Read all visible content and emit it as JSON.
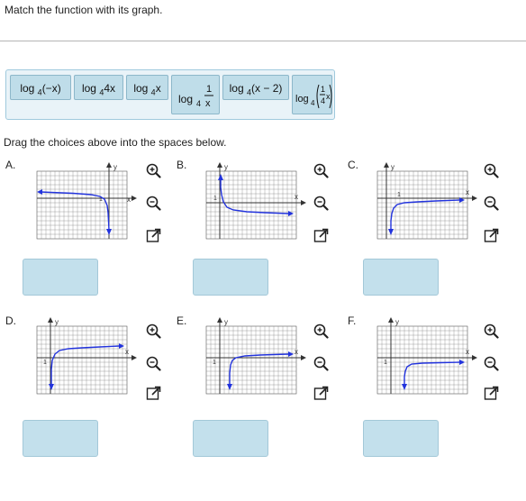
{
  "question": {
    "prompt": "Match the function with its graph."
  },
  "choices": [
    {
      "id": "c1",
      "text": "log 4(−x)"
    },
    {
      "id": "c2",
      "text": "log 4 4x"
    },
    {
      "id": "c3",
      "text": "log 4 x"
    },
    {
      "id": "c4",
      "text": "log 4 1/x",
      "prefix": "log",
      "sub": "4",
      "num": "1",
      "den": "x"
    },
    {
      "id": "c5",
      "text": "log 4(x − 2)"
    },
    {
      "id": "c6",
      "text": "log 4 (1/4 x)",
      "prefix": "log",
      "sub": "4",
      "num": "1",
      "den": "4",
      "var": "x"
    }
  ],
  "instruction": "Drag the choices above into the spaces below.",
  "graphs": [
    {
      "letter": "A.",
      "xlabel": "x",
      "ylabel": "y",
      "tick": "1"
    },
    {
      "letter": "B.",
      "xlabel": "x",
      "ylabel": "y",
      "tick": "1"
    },
    {
      "letter": "C.",
      "xlabel": "x",
      "ylabel": "y",
      "tick": "1"
    },
    {
      "letter": "D.",
      "xlabel": "x",
      "ylabel": "y",
      "tick": "1"
    },
    {
      "letter": "E.",
      "xlabel": "x",
      "ylabel": "y",
      "tick": "1"
    },
    {
      "letter": "F.",
      "xlabel": "x",
      "ylabel": "y",
      "tick": "1"
    }
  ],
  "icons": {
    "zoom_in": "zoom-in-icon",
    "zoom_out": "zoom-out-icon",
    "expand": "expand-icon"
  },
  "colors": {
    "curve": "#2233dd",
    "axis": "#2233dd",
    "grid": "#555555",
    "drop_zone": "#c3e0ec",
    "choice_tile": "#bfdde9"
  }
}
